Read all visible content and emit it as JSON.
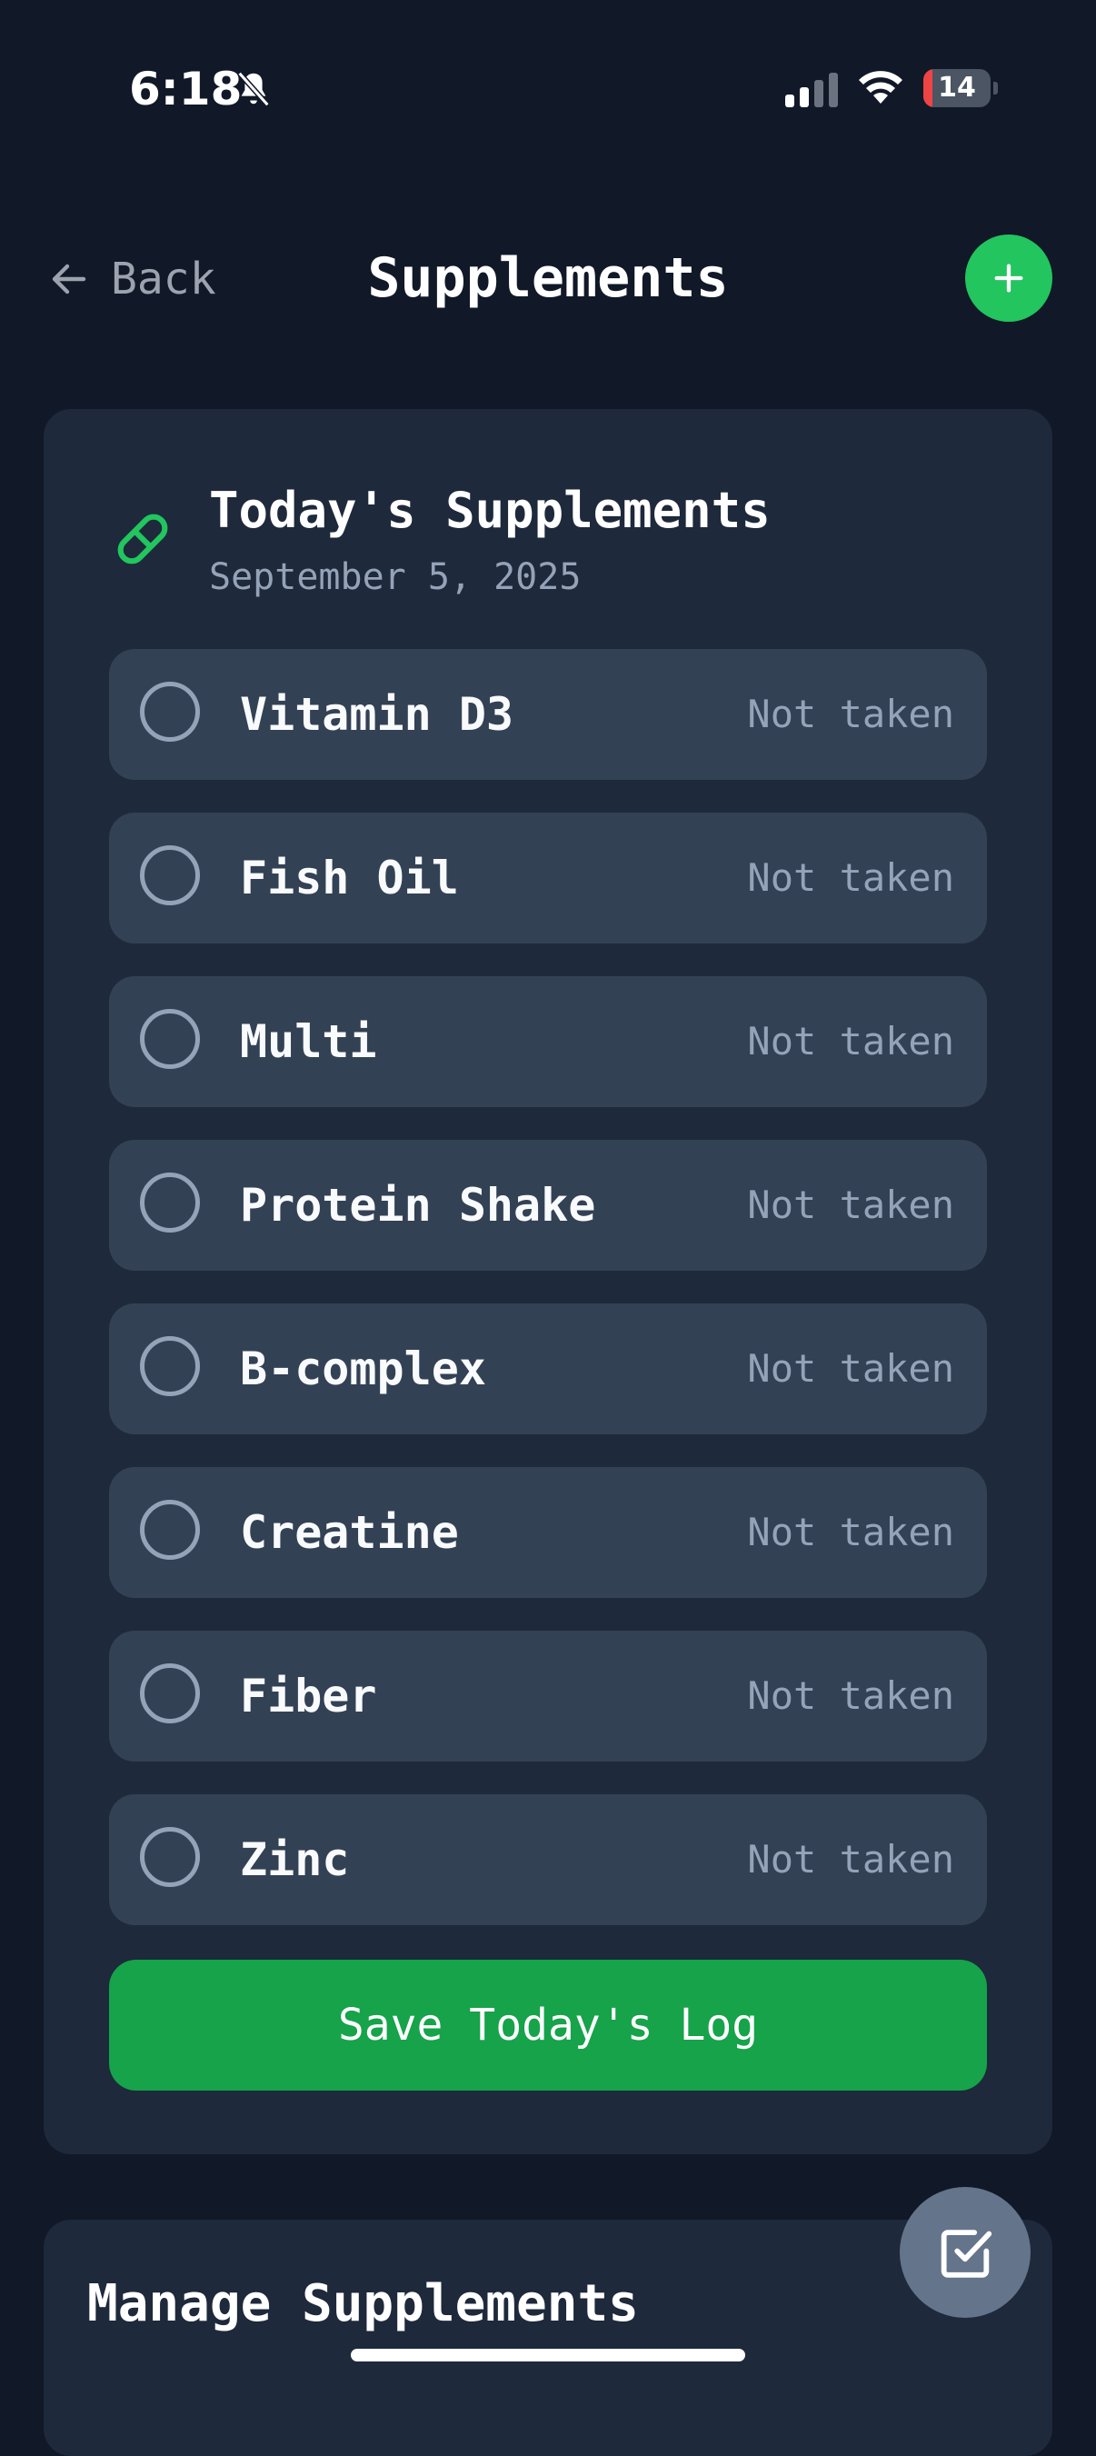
{
  "status_bar": {
    "time": "6:18",
    "battery": "14",
    "battery_level": 0.14,
    "icons": [
      "bell-slash-icon",
      "signal-icon",
      "wifi-icon",
      "battery-icon"
    ]
  },
  "header": {
    "back_label": "Back",
    "title": "Supplements",
    "add_icon": "plus-icon"
  },
  "today": {
    "title": "Today's Supplements",
    "date": "September 5, 2025",
    "icon": "pill-icon",
    "items": [
      {
        "name": "Vitamin D3",
        "status": "Not taken"
      },
      {
        "name": "Fish Oil",
        "status": "Not taken"
      },
      {
        "name": "Multi",
        "status": "Not taken"
      },
      {
        "name": "Protein Shake",
        "status": "Not taken"
      },
      {
        "name": "B-complex",
        "status": "Not taken"
      },
      {
        "name": "Creatine",
        "status": "Not taken"
      },
      {
        "name": "Fiber",
        "status": "Not taken"
      },
      {
        "name": "Zinc",
        "status": "Not taken"
      }
    ],
    "save_label": "Save Today's Log"
  },
  "manage": {
    "title": "Manage Supplements"
  },
  "fab": {
    "icon": "checkbox-icon"
  },
  "colors": {
    "background": "#111827",
    "card": "#1e293b",
    "item": "#334155",
    "accent": "#22c55e",
    "save_button": "#16a34a",
    "muted": "#94a3b8"
  }
}
